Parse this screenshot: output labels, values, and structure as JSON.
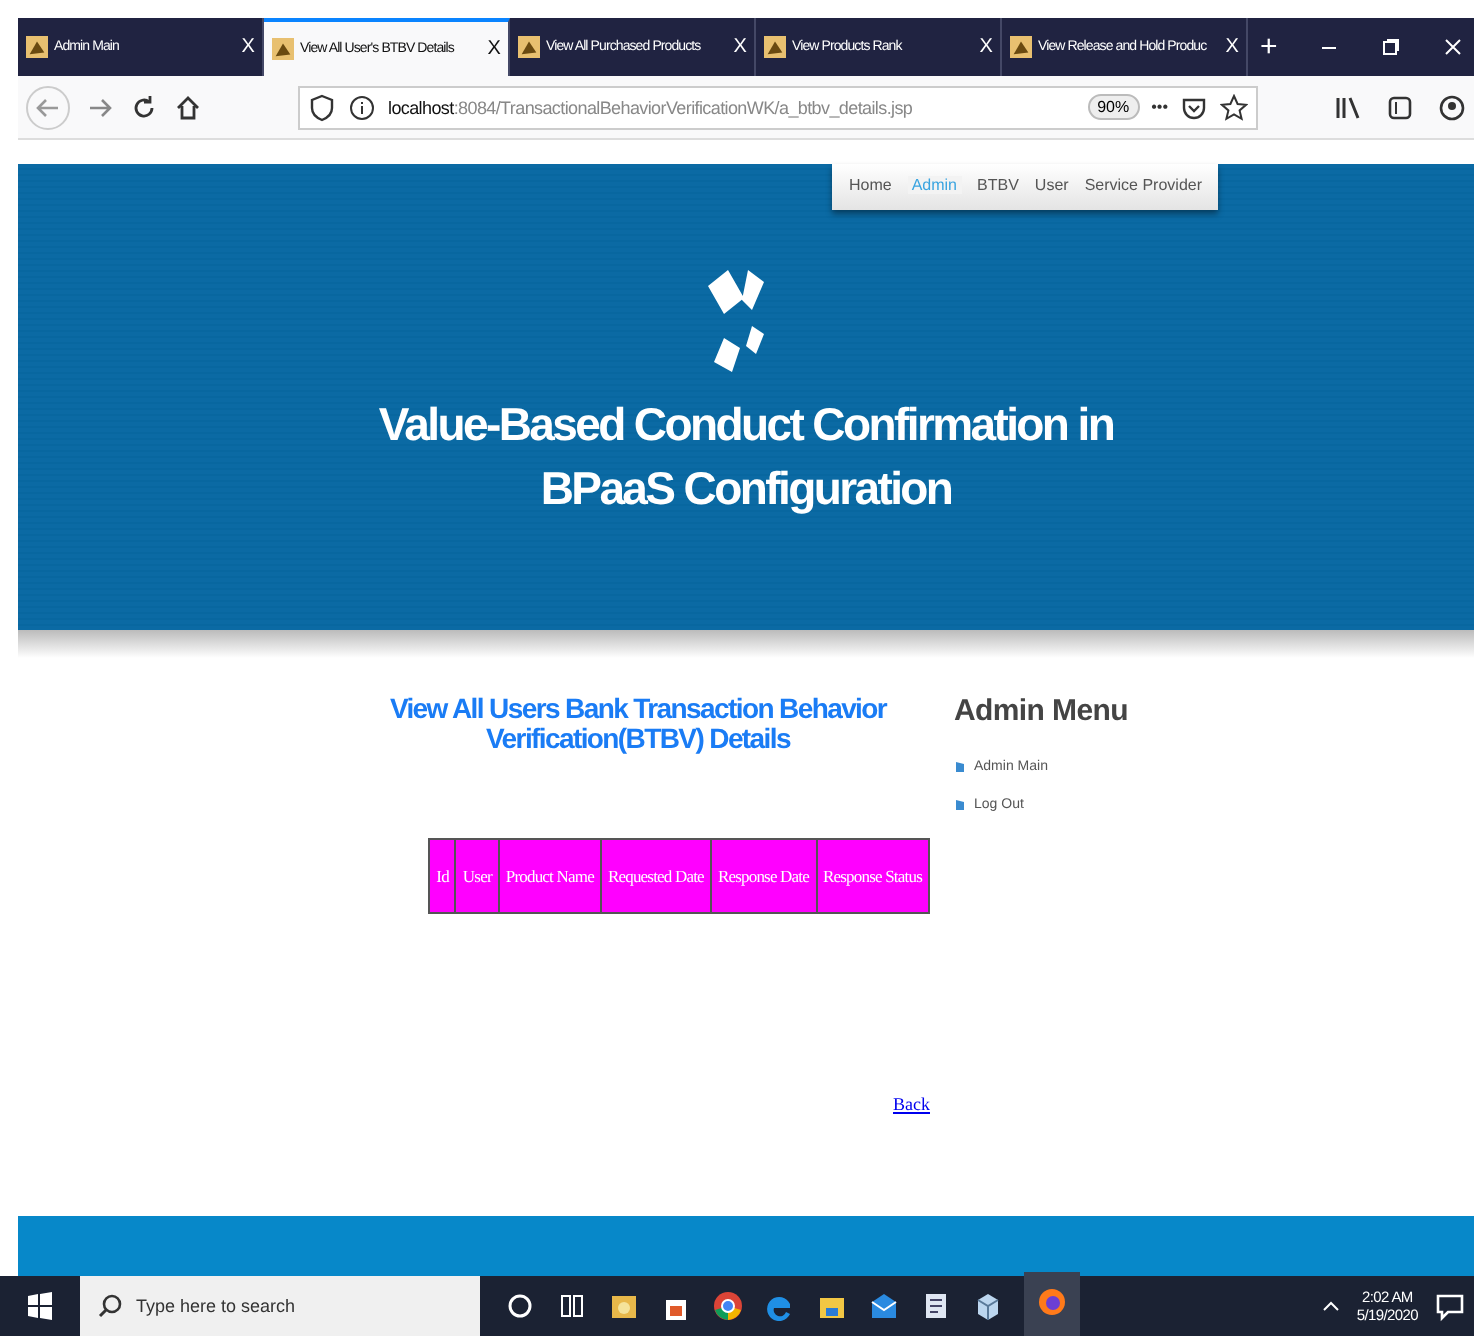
{
  "browser": {
    "tabs": [
      {
        "title": "Admin Main",
        "close": "X",
        "selected": false
      },
      {
        "title": "View All User's BTBV Details",
        "close": "X",
        "selected": true
      },
      {
        "title": "View All Purchased Products",
        "close": "X",
        "selected": false
      },
      {
        "title": "View Products Rank",
        "close": "X",
        "selected": false
      },
      {
        "title": "View Release and Hold Produc",
        "close": "X",
        "selected": false
      }
    ],
    "new_tab": "+",
    "address": "**localhost**:8084/TransactionalBehaviorVerificationWK/a_btbv_details.jsp",
    "zoom": "90%",
    "more": "•••"
  },
  "site": {
    "nav": [
      {
        "label": "Home",
        "selected": false
      },
      {
        "label": "Admin",
        "selected": true
      },
      {
        "label": "BTBV",
        "selected": false
      },
      {
        "label": "User",
        "selected": false
      },
      {
        "label": "Service Provider",
        "selected": false
      }
    ],
    "title": "Value-Based Conduct Confirmation in BPaaS Configuration",
    "heading": "View All Users Bank Transaction Behavior Verification(BTBV) Details",
    "table": {
      "columns": [
        "Id",
        "User",
        "Product Name",
        "Requested Date",
        "Response Date",
        "Response Status"
      ]
    },
    "back": "Back",
    "sidebar": {
      "title": "Admin Menu",
      "items": [
        "Admin Main",
        "Log Out"
      ]
    }
  },
  "taskbar": {
    "search": {
      "placeholder": "Type here to search"
    },
    "time": "2:02 AM",
    "date": "5/19/2020"
  }
}
